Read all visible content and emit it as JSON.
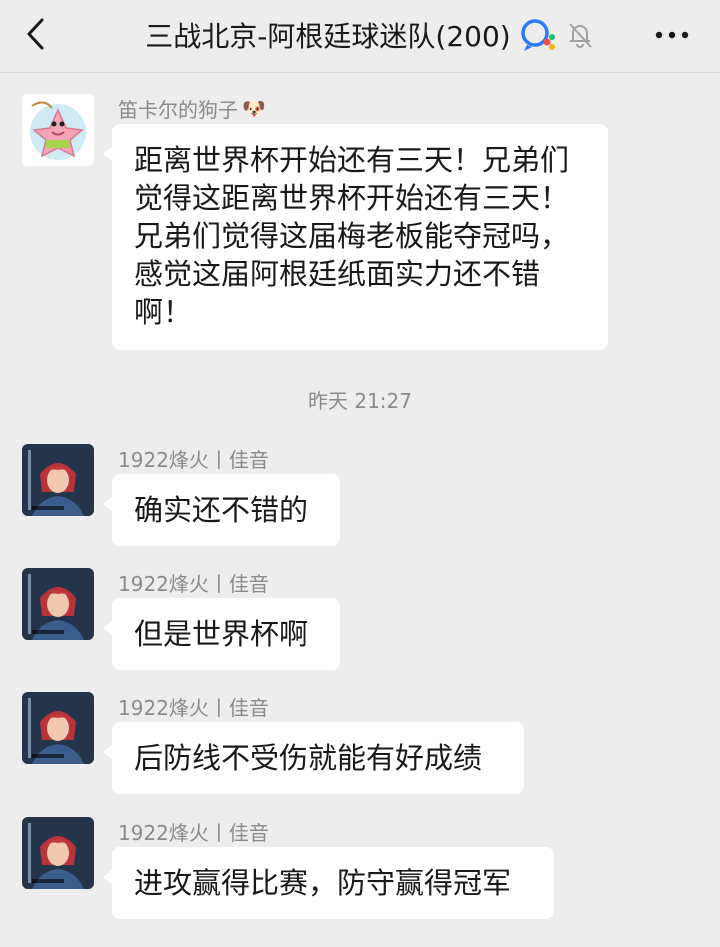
{
  "header": {
    "back_icon": "chevron-left-icon",
    "title": "三战北京-阿根廷球迷队(200)",
    "group_icon": "group-chat-icon",
    "mute_icon": "bell-off-icon",
    "more_icon": "more-horizontal-icon"
  },
  "messages": [
    {
      "sender": "笛卡尔的狗子",
      "sender_emoji": "🐶",
      "text": "距离世界杯开始还有三天！兄弟们觉得这距离世界杯开始还有三天！兄弟们觉得这届梅老板能夺冠吗，感觉这届阿根廷纸面实力还不错啊！"
    },
    {
      "sender": "1922烽火丨佳音",
      "text": "确实还不错的"
    },
    {
      "sender": "1922烽火丨佳音",
      "text": "但是世界杯啊"
    },
    {
      "sender": "1922烽火丨佳音",
      "text": "后防线不受伤就能有好成绩"
    },
    {
      "sender": "1922烽火丨佳音",
      "text": "进攻赢得比赛，防守赢得冠军"
    }
  ],
  "timestamp": "昨天 21:27"
}
